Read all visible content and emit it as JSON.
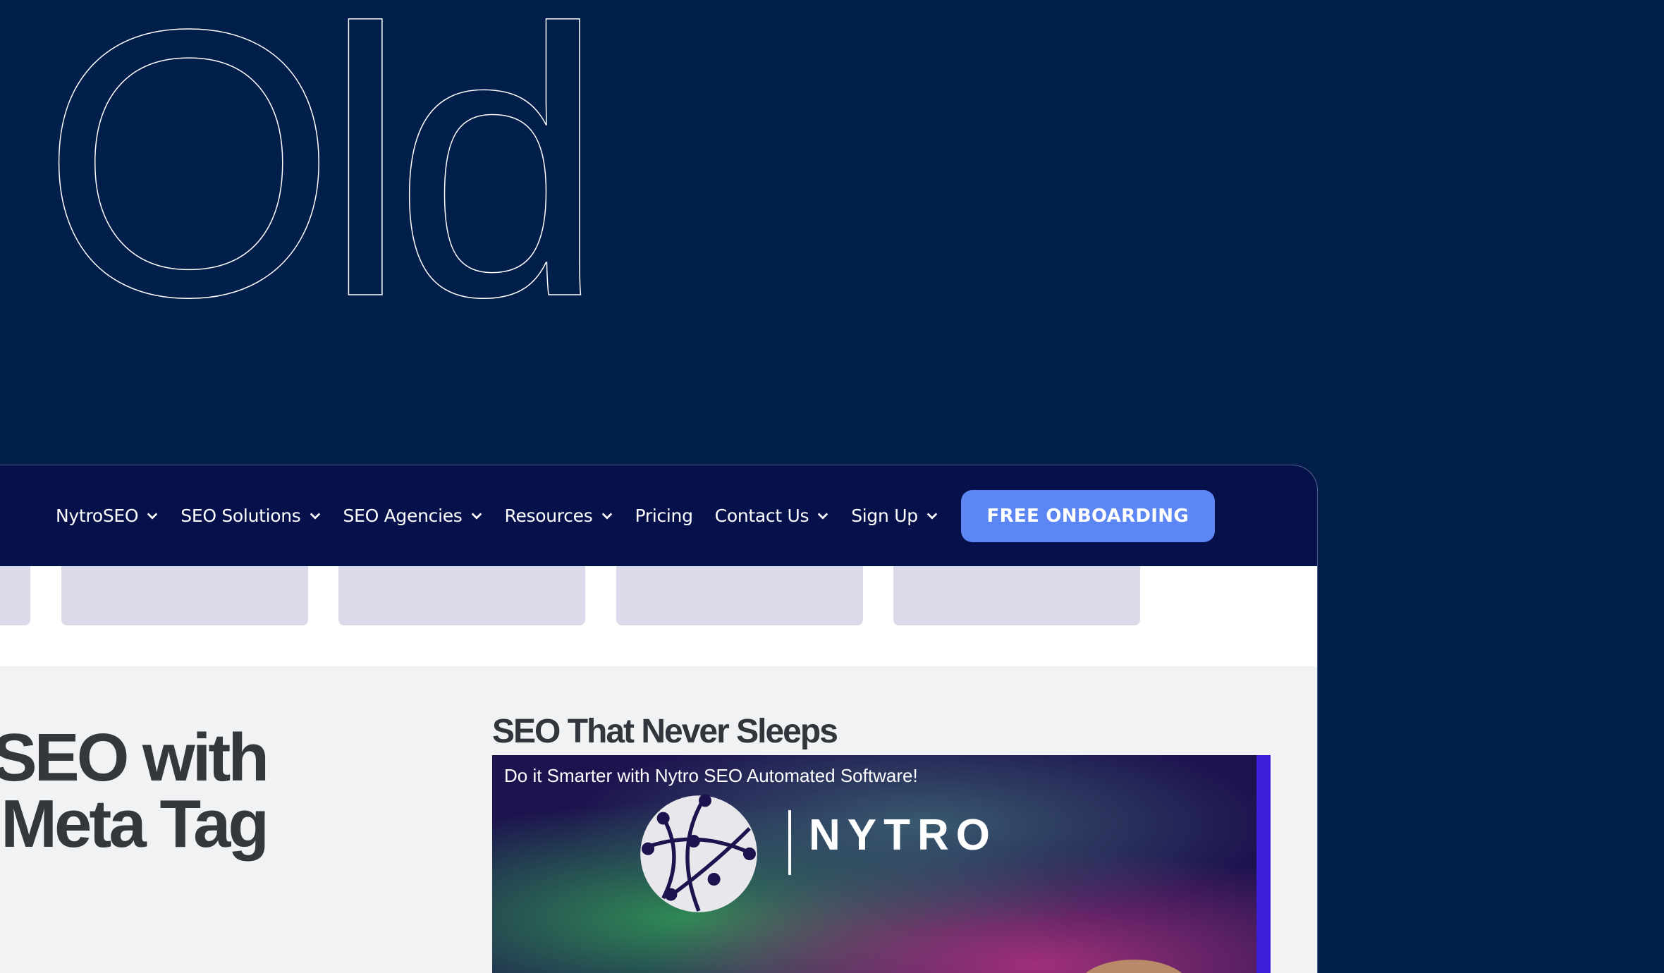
{
  "hero": {
    "word": "Old"
  },
  "nav": {
    "items": [
      {
        "label": "NytroSEO",
        "has_dropdown": true
      },
      {
        "label": "SEO Solutions",
        "has_dropdown": true
      },
      {
        "label": "SEO Agencies",
        "has_dropdown": true
      },
      {
        "label": "Resources",
        "has_dropdown": true
      },
      {
        "label": "Pricing",
        "has_dropdown": false
      },
      {
        "label": "Contact Us",
        "has_dropdown": true
      },
      {
        "label": "Sign Up",
        "has_dropdown": true
      }
    ],
    "cta_label": "FREE ONBOARDING"
  },
  "main": {
    "headline_line1": "ng SEO with",
    "headline_line2": "Meta Tag",
    "video_section_title": "SEO That Never Sleeps",
    "video": {
      "caption": "Do it Smarter with Nytro SEO Automated Software!",
      "logo_text": "NYTRO"
    }
  },
  "colors": {
    "background": "#021e4a",
    "navbar": "#06104a",
    "cta": "#5b86f4",
    "tab_card": "#dcdaea",
    "content_bg": "#f1f2f4"
  },
  "icons": [
    "chevron-down-icon",
    "globe-logo-icon"
  ]
}
